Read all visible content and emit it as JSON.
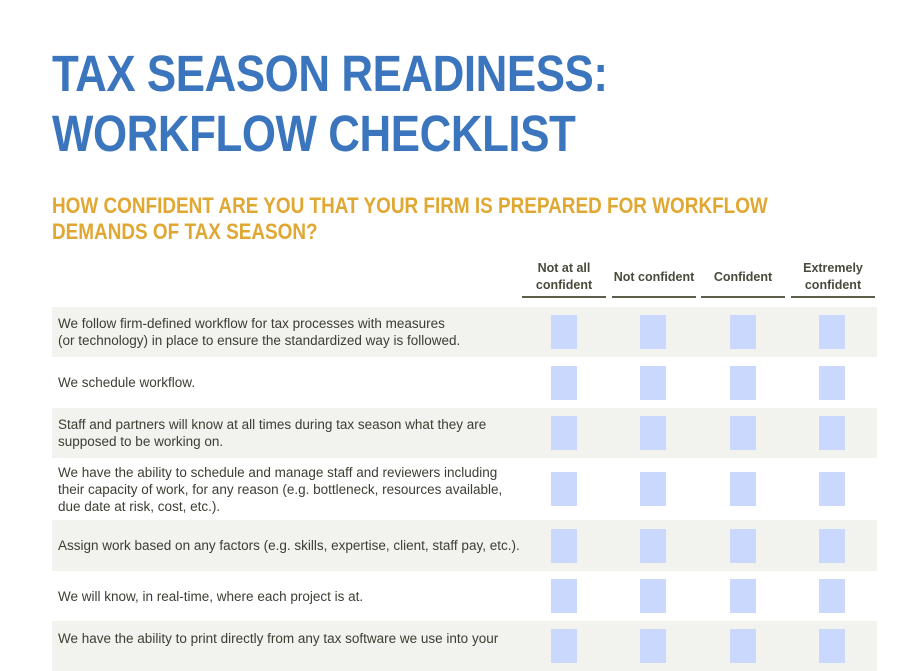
{
  "title": {
    "line1": "TAX SEASON READINESS:",
    "line2": "WORKFLOW CHECKLIST"
  },
  "question": {
    "line1": "HOW CONFIDENT ARE YOU THAT YOUR FIRM IS PREPARED FOR WORKFLOW",
    "line2": "DEMANDS OF TAX SEASON?"
  },
  "colors": {
    "title": "#3a75bd",
    "question": "#e0a832",
    "checkbox": "#cbd8fd",
    "row_shade": "#f2f2ee"
  },
  "columns": [
    {
      "line1": "Not at all",
      "line2": "confident"
    },
    {
      "line1": "Not confident",
      "line2": ""
    },
    {
      "line1": "Confident",
      "line2": ""
    },
    {
      "line1": "Extremely",
      "line2": "confident"
    }
  ],
  "rows": [
    {
      "lines": [
        "We follow firm-defined workflow for tax processes with measures",
        "(or technology) in place to ensure the standardized way is followed."
      ],
      "checked": [
        false,
        false,
        false,
        false
      ]
    },
    {
      "lines": [
        "We schedule workflow."
      ],
      "checked": [
        false,
        false,
        false,
        false
      ]
    },
    {
      "lines": [
        "Staff and partners will know at all times during tax season what they are",
        "supposed to be working on."
      ],
      "checked": [
        false,
        false,
        false,
        false
      ]
    },
    {
      "lines": [
        "We have the ability to schedule and manage staff and reviewers including",
        "their capacity of work, for any reason (e.g. bottleneck, resources available,",
        "due date at risk, cost, etc.)."
      ],
      "checked": [
        false,
        false,
        false,
        false
      ]
    },
    {
      "lines": [
        "Assign work based on any factors (e.g. skills, expertise, client, staff pay, etc.)."
      ],
      "checked": [
        false,
        false,
        false,
        false
      ]
    },
    {
      "lines": [
        "We will know, in real-time, where each project is at."
      ],
      "checked": [
        false,
        false,
        false,
        false
      ]
    },
    {
      "lines": [
        "We have the ability to print directly from any tax software we use into your"
      ],
      "checked": [
        false,
        false,
        false,
        false
      ]
    }
  ]
}
